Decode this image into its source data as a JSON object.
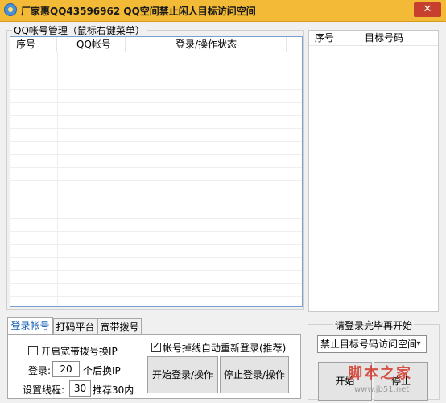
{
  "window": {
    "title": "厂家惠QQ43596962 QQ空间禁止闲人目标访问空间",
    "close_glyph": "✕"
  },
  "accounts_group": {
    "title": "QQ帐号管理（鼠标右键菜单）",
    "columns": [
      "序号",
      "QQ帐号",
      "登录/操作状态"
    ]
  },
  "targets_list": {
    "columns": [
      "序号",
      "目标号码"
    ]
  },
  "tabs": [
    {
      "label": "登录帐号",
      "active": true
    },
    {
      "label": "打码平台",
      "active": false
    },
    {
      "label": "宽带拨号",
      "active": false
    }
  ],
  "login_tab": {
    "broadband_checkbox_label": "开启宽带拨号换IP",
    "broadband_checked": false,
    "login_label": "登录:",
    "login_value": "20",
    "login_suffix": "个后换IP",
    "threads_label": "设置线程:",
    "threads_value": "30",
    "threads_suffix": "推荐30内",
    "auto_relogin_label": "帐号掉线自动重新登录(推荐)",
    "auto_relogin_checked": true,
    "start_button": "开始登录/操作",
    "stop_button": "停止登录/操作"
  },
  "right_panel": {
    "hint": "请登录完毕再开始",
    "mode_select_value": "禁止目标号码访问空间",
    "start_button": "开始",
    "stop_button": "停止"
  },
  "watermark": {
    "text": "脚本之家",
    "url": "www.jb51.net"
  },
  "colors": {
    "titlebar": "#f2ba36",
    "list_border": "#7aa0cc",
    "active_tab_text": "#1560b8",
    "watermark": "#d33a2a"
  }
}
